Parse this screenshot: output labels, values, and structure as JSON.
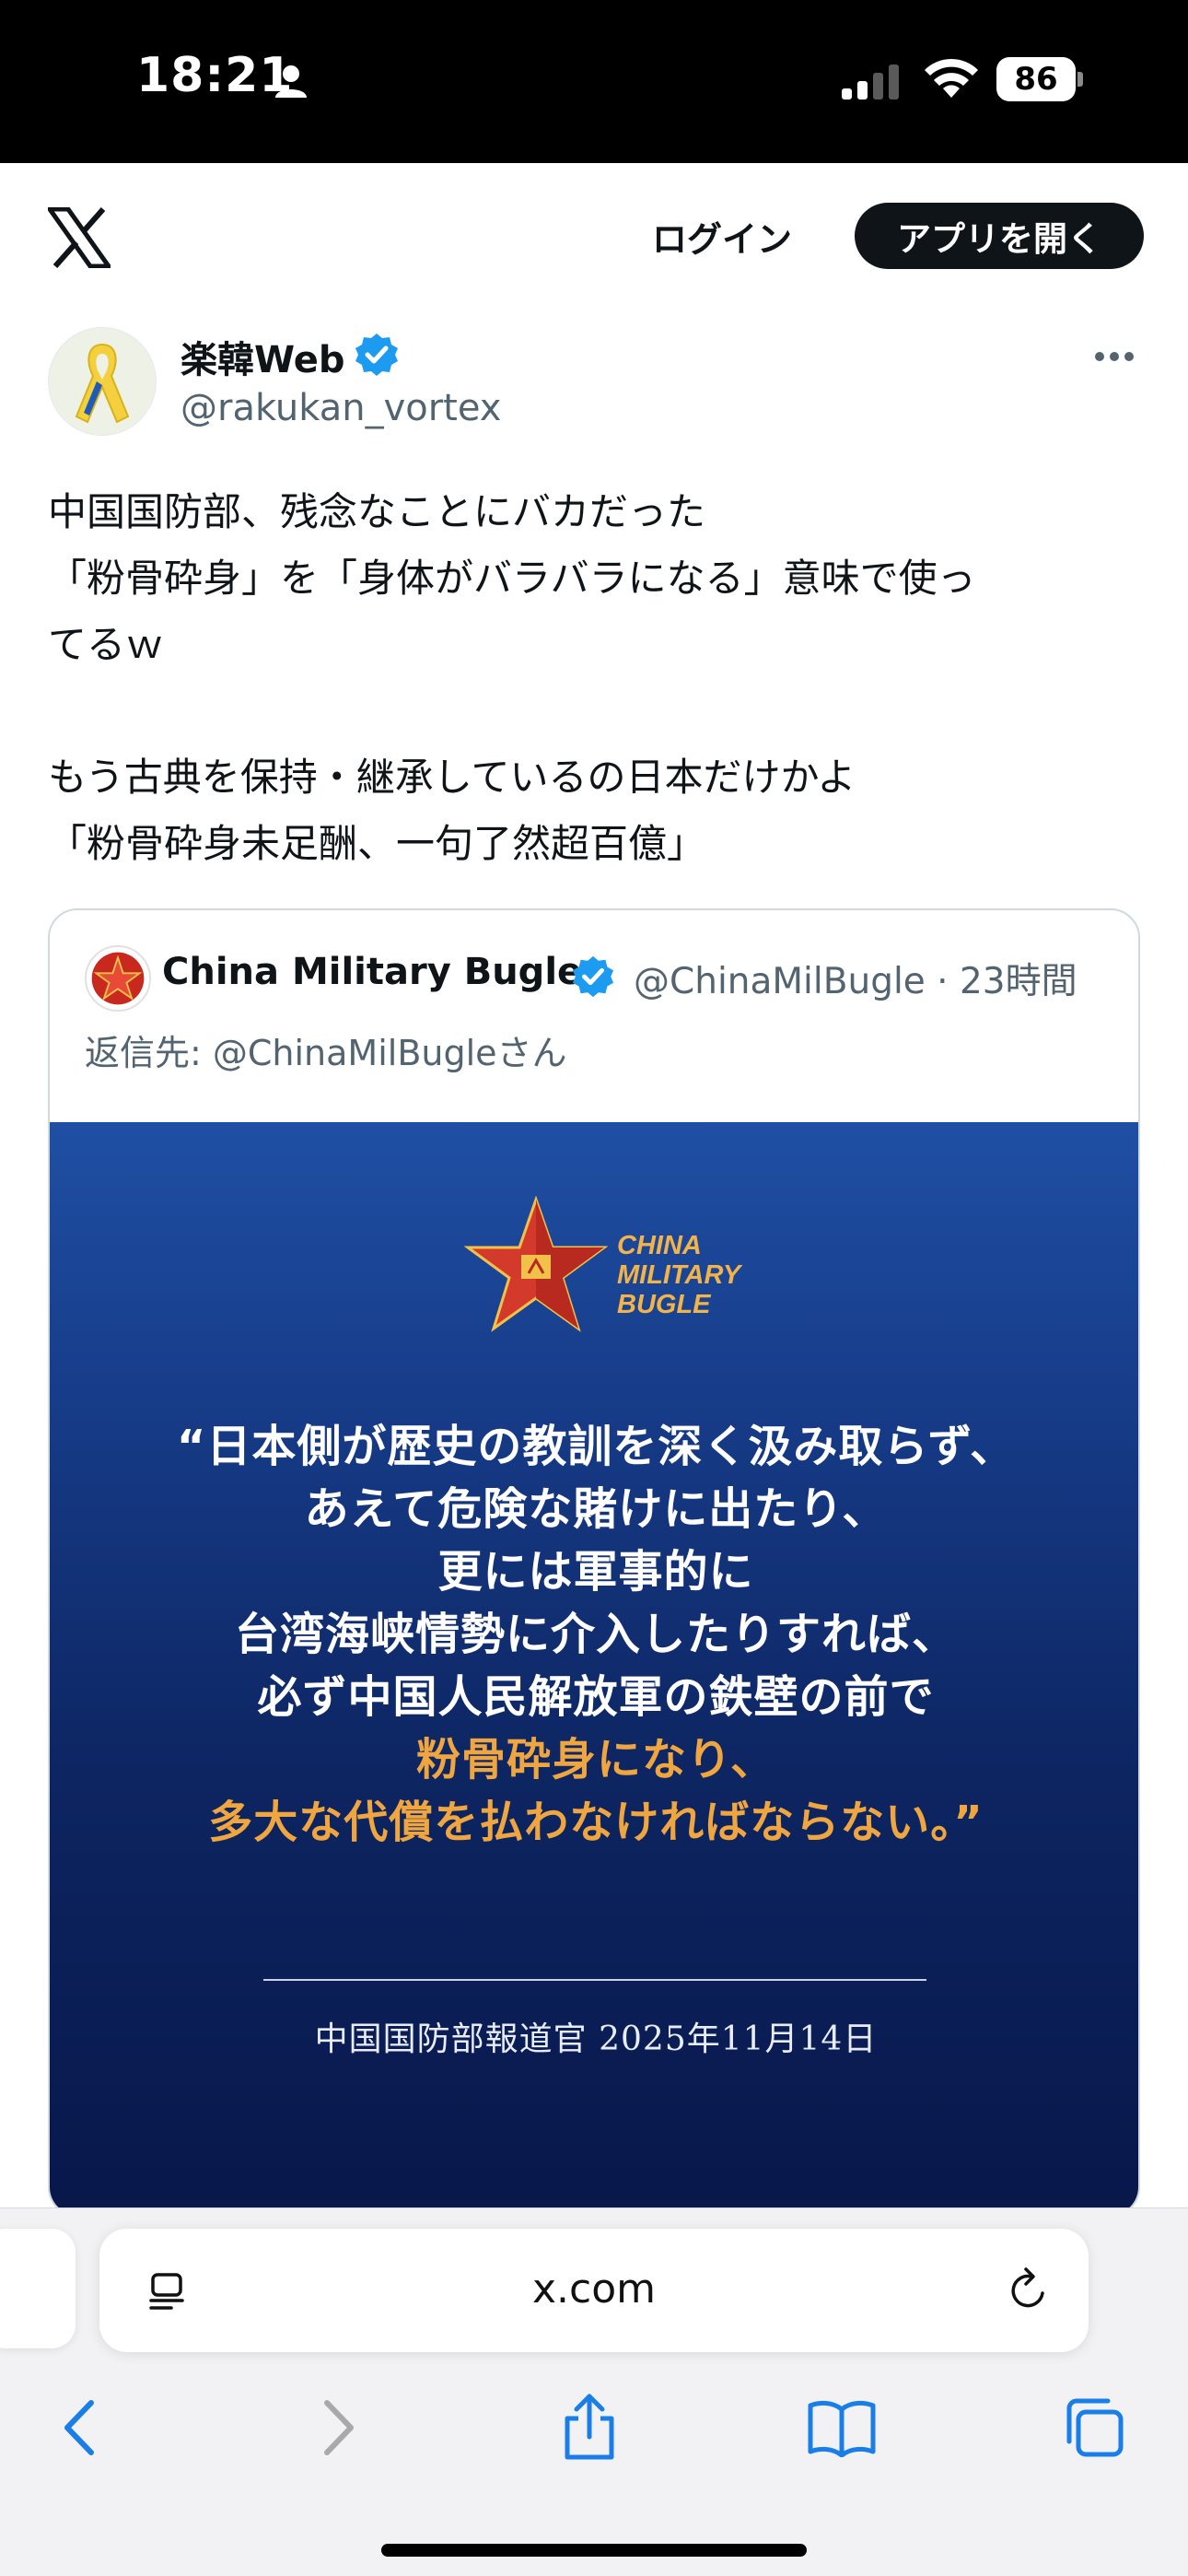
{
  "status_bar": {
    "time": "18:21",
    "battery": "86",
    "icons": [
      "person-icon",
      "signal-icon",
      "wifi-icon",
      "battery-icon"
    ]
  },
  "header": {
    "logo": "x-logo-icon",
    "login_label": "ログイン",
    "open_app_label": "アプリを開く"
  },
  "tweet": {
    "author_name": "楽韓Web",
    "author_handle": "@rakukan_vortex",
    "verified": true,
    "text_lines": [
      "中国国防部、残念なことにバカだった",
      "「粉骨砕身」を「身体がバラバラになる」意味で使っ",
      "てるｗ",
      "",
      "もう古典を保持・継承しているの日本だけかよ",
      "「粉骨砕身未足酬、一句了然超百億」"
    ]
  },
  "quote": {
    "author_name": "China Military Bugle",
    "handle_time": "@ChinaMilBugle · 23時間",
    "reply_to": "返信先: @ChinaMilBugleさん",
    "image": {
      "logo_lines": [
        "CHINA",
        "MILITARY",
        "BUGLE"
      ],
      "quote_lines": [
        "“日本側が歴史の教訓を深く汲み取らず、",
        "あえて危険な賭けに出たり、",
        "更には軍事的に",
        "台湾海峡情勢に介入したりすれば、",
        "必ず中国人民解放軍の鉄壁の前で",
        "粉骨砕身になり、",
        "多大な代償を払わなければならない。”"
      ],
      "caption": "中国国防部報道官  2025年11月14日",
      "highlight_color": "#f0a640"
    }
  },
  "browser": {
    "url": "x.com",
    "accent": "#1a7ee8"
  }
}
